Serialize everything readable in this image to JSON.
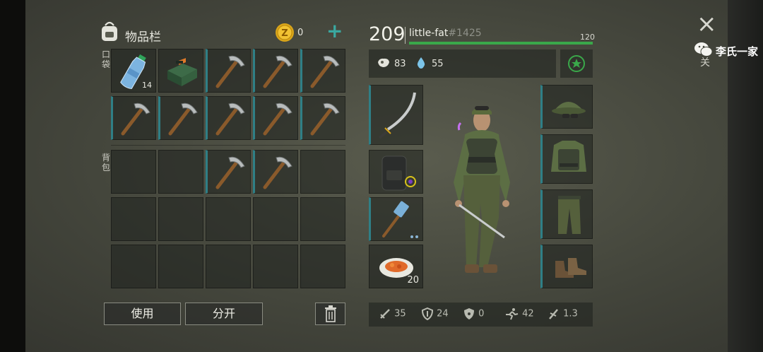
{
  "inventory": {
    "title": "物品栏",
    "coins": "0",
    "add_symbol": "+",
    "pocket_label": "口袋",
    "backpack_label": "背包",
    "use_button": "使用",
    "split_button": "分开",
    "pocket_items": [
      {
        "icon": "water-bottle-icon",
        "qty": "14"
      },
      {
        "icon": "green-case-icon",
        "qty": ""
      },
      {
        "icon": "pickaxe-icon",
        "qty": ""
      },
      {
        "icon": "pickaxe-icon",
        "qty": ""
      },
      {
        "icon": "pickaxe-icon",
        "qty": ""
      },
      {
        "icon": "pickaxe-icon",
        "qty": ""
      },
      {
        "icon": "pickaxe-icon",
        "qty": ""
      },
      {
        "icon": "pickaxe-icon",
        "qty": ""
      },
      {
        "icon": "pickaxe-icon",
        "qty": ""
      },
      {
        "icon": "pickaxe-icon",
        "qty": ""
      }
    ],
    "backpack_items": [
      "",
      "",
      "pickaxe-icon",
      "pickaxe-icon",
      "",
      "",
      "",
      "",
      "",
      "",
      "",
      "",
      "",
      "",
      ""
    ]
  },
  "player": {
    "level": "209",
    "name": "little-fat",
    "tag": "#1425",
    "health": "120",
    "hunger": "83",
    "thirst": "55"
  },
  "equipment": {
    "food_qty": "20"
  },
  "stats": {
    "attack": "35",
    "defense": "24",
    "radiation": "0",
    "speed": "42",
    "weight": "1.3"
  },
  "watermark": "李氏一家",
  "close_glyph": "×",
  "close_label": "关",
  "colors": {
    "accent": "#3aa84a",
    "durability": "#2f7f86",
    "plus": "#3aa8a0"
  }
}
